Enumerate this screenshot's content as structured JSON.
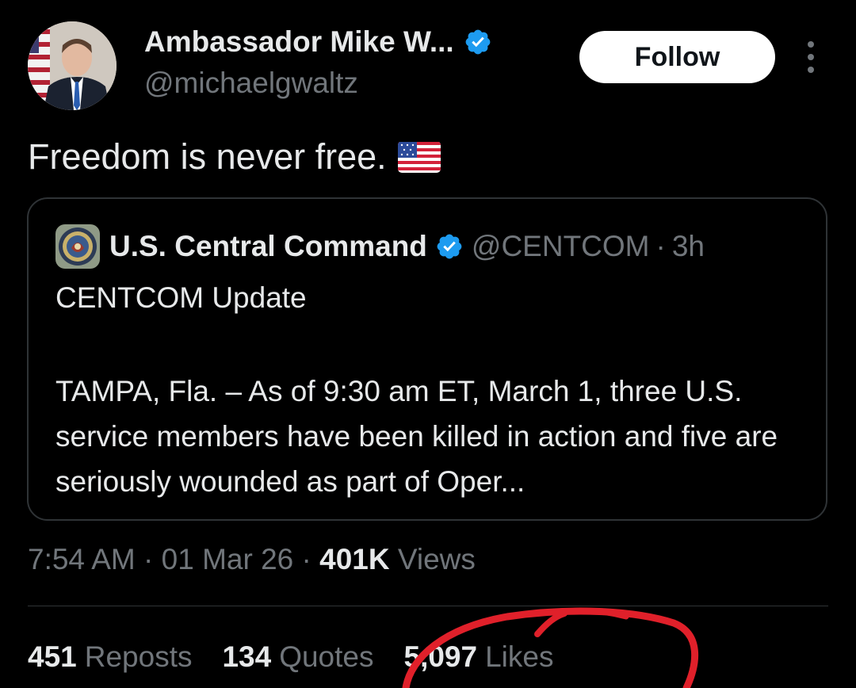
{
  "author": {
    "display_name": "Ambassador Mike W...",
    "handle": "@michaelgwaltz",
    "avatar_icon": "profile-photo",
    "verified_icon": "verified-badge-icon"
  },
  "follow_label": "Follow",
  "more_icon": "more-vertical-icon",
  "tweet": {
    "text": "Freedom is never free.",
    "emoji_icon": "us-flag-emoji"
  },
  "quote": {
    "name": "U.S. Central Command",
    "handle": "@CENTCOM",
    "separator": "·",
    "time": "3h",
    "title": "CENTCOM Update",
    "body": "TAMPA, Fla. – As of 9:30 am ET, March 1, three U.S. service members have been killed in action and five are seriously wounded as part of Oper..."
  },
  "meta": {
    "time": "7:54 AM",
    "sep1": "·",
    "date": "01 Mar 26",
    "sep2": "·",
    "views_count": "401K",
    "views_label": "Views"
  },
  "stats": {
    "reposts_count": "451",
    "reposts_label": "Reposts",
    "quotes_count": "134",
    "quotes_label": "Quotes",
    "likes_count": "5,097",
    "likes_label": "Likes"
  },
  "colors": {
    "background": "#000000",
    "text_primary": "#e7e9ea",
    "text_secondary": "#71767b",
    "verified_blue": "#1d9bf0",
    "annotation_red": "#e0202a"
  }
}
